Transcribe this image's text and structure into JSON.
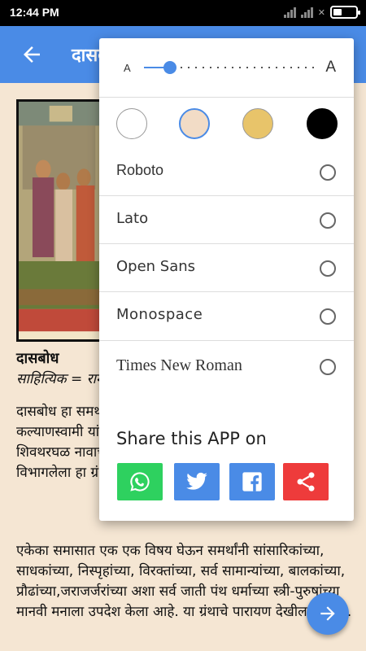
{
  "status_bar": {
    "time": "12:44 PM"
  },
  "app_bar": {
    "title": "दासबोध"
  },
  "article": {
    "title": "दासबोध",
    "subtitle": "साहित्यिक = रामदास",
    "paragraph1": "दासबोध हा समर्थ रामदासांचा ग्रंथ आहे. समर्थांचे पट्टशिष्य कल्याणस्वामी यांनी तो लिहून घेतला. अत्यंत निबीड अरण्यात शिवथरघळ नावाच्या ठिकाणी हे लेखन झाले. वीस दशकांमध्ये विभागलेला हा ग्रंथ आहे.",
    "paragraph2": "एकेका समासात एक एक विषय घेऊन समर्थांनी सांसारिकांच्या, साधकांच्या, निस्पृहांच्या, विरक्तांच्या, सर्व सामान्यांच्या, बालकांच्या, प्रौढांच्या,जराजर्जरांच्या अशा सर्व जाती पंथ धर्माच्या स्त्री-पुरुषांच्या मानवी मनाला उपदेश केला आहे. या ग्रंथाचे पारायण देखील करतात."
  },
  "menu": {
    "font_size": {
      "small_label": "A",
      "large_label": "A",
      "level": 0.15
    },
    "themes": [
      {
        "name": "white",
        "color": "#ffffff",
        "selected": false
      },
      {
        "name": "sepia",
        "color": "#f2dcc6",
        "selected": true
      },
      {
        "name": "tan",
        "color": "#e8c46a",
        "selected": false
      },
      {
        "name": "black",
        "color": "#000000",
        "selected": false
      }
    ],
    "fonts": [
      {
        "label": "Roboto",
        "selected": false
      },
      {
        "label": "Lato",
        "selected": false
      },
      {
        "label": "Open Sans",
        "selected": false
      },
      {
        "label": "Monospace",
        "selected": false
      },
      {
        "label": "Times New Roman",
        "selected": false
      }
    ],
    "share_title": "Share this APP on",
    "share_buttons": [
      {
        "name": "whatsapp",
        "color": "#2ed15f"
      },
      {
        "name": "twitter",
        "color": "#4a8be6"
      },
      {
        "name": "facebook",
        "color": "#4a8be6"
      },
      {
        "name": "share",
        "color": "#ee3b3b"
      }
    ]
  }
}
